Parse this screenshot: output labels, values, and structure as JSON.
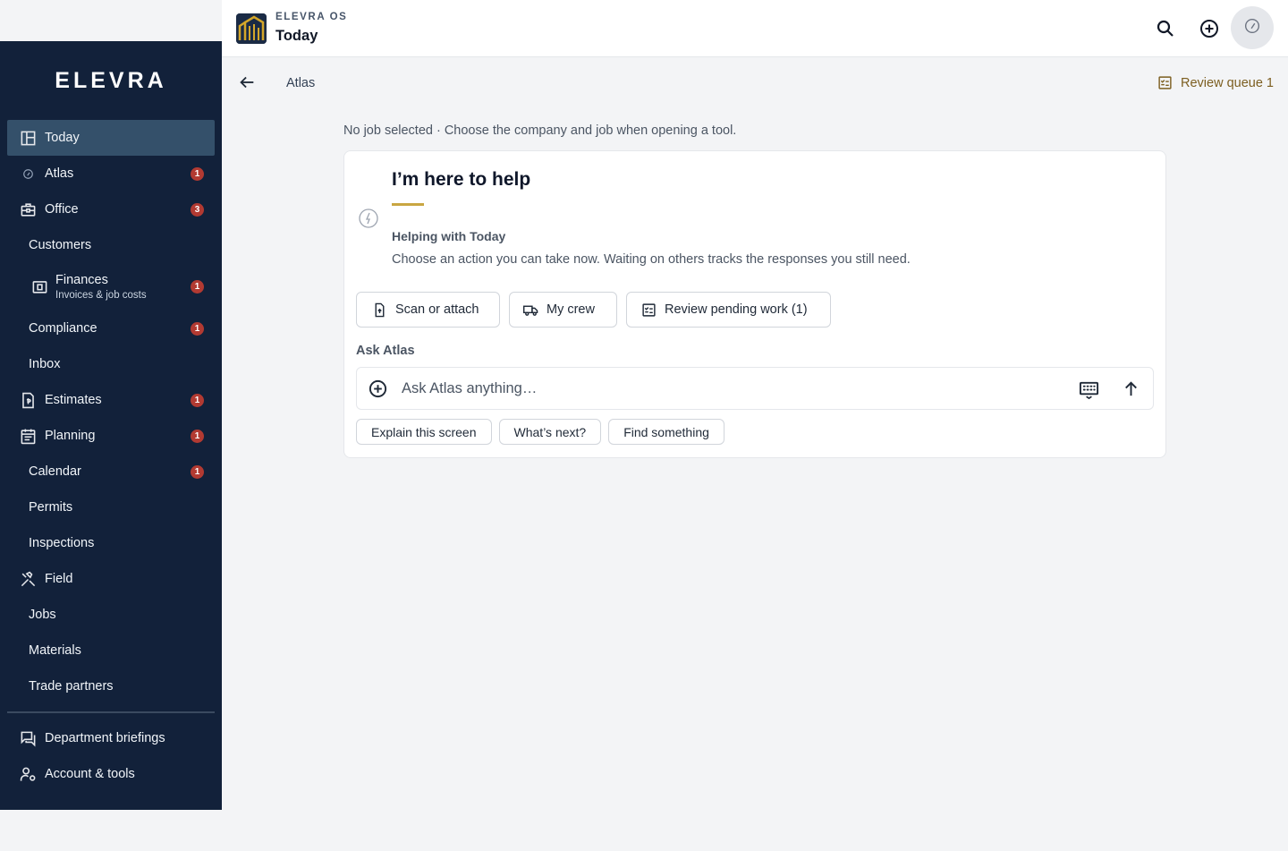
{
  "sidebar": {
    "logo": "ELEVRA",
    "items": [
      {
        "label": "Today",
        "icon": "dashboard-icon",
        "active": true
      },
      {
        "label": "Atlas",
        "icon": "compass-icon",
        "badge": "1"
      },
      {
        "label": "Office",
        "icon": "briefcase-icon",
        "badge": "3"
      },
      {
        "label": "Customers"
      },
      {
        "label": "Finances",
        "sublabel": "Invoices & job costs",
        "icon": "wallet-icon",
        "badge": "1"
      },
      {
        "label": "Compliance",
        "badge": "1"
      },
      {
        "label": "Inbox"
      },
      {
        "label": "Estimates",
        "icon": "invoice-icon",
        "badge": "1"
      },
      {
        "label": "Planning",
        "icon": "calendar-icon",
        "badge": "1"
      },
      {
        "label": "Calendar",
        "badge": "1"
      },
      {
        "label": "Permits"
      },
      {
        "label": "Inspections"
      },
      {
        "label": "Field",
        "icon": "tools-icon"
      },
      {
        "label": "Jobs"
      },
      {
        "label": "Materials"
      },
      {
        "label": "Trade partners"
      },
      {
        "label": "Department briefings",
        "icon": "chat-icon"
      },
      {
        "label": "Account & tools",
        "icon": "user-settings-icon"
      }
    ]
  },
  "header": {
    "app_name": "ELEVRA OS",
    "page_title": "Today",
    "icons": [
      "search-icon",
      "add-circle-icon",
      "compass-icon"
    ]
  },
  "subbar": {
    "breadcrumb": "Atlas",
    "review_queue": "Review queue 1"
  },
  "context": {
    "no_job": "No job selected · Choose the company and job when opening a tool."
  },
  "card": {
    "title": "I’m here to help",
    "helping_label": "Helping with Today",
    "helping_desc": "Choose an action you can take now. Waiting on others tracks the responses you still need.",
    "actions": [
      {
        "label": "Scan or attach",
        "icon": "upload-file-icon"
      },
      {
        "label": "My crew",
        "icon": "truck-icon"
      },
      {
        "label": "Review pending work (1)",
        "icon": "checklist-icon"
      }
    ],
    "ask_label": "Ask Atlas",
    "ask_placeholder": "Ask Atlas anything…",
    "chips": [
      "Explain this screen",
      "What’s next?",
      "Find something"
    ]
  },
  "colors": {
    "sidebar_bg": "#12213a",
    "active_item": "#34506a",
    "badge": "#b23a32",
    "accent_gold": "#c9a642",
    "review_queue": "#7c5e20"
  }
}
